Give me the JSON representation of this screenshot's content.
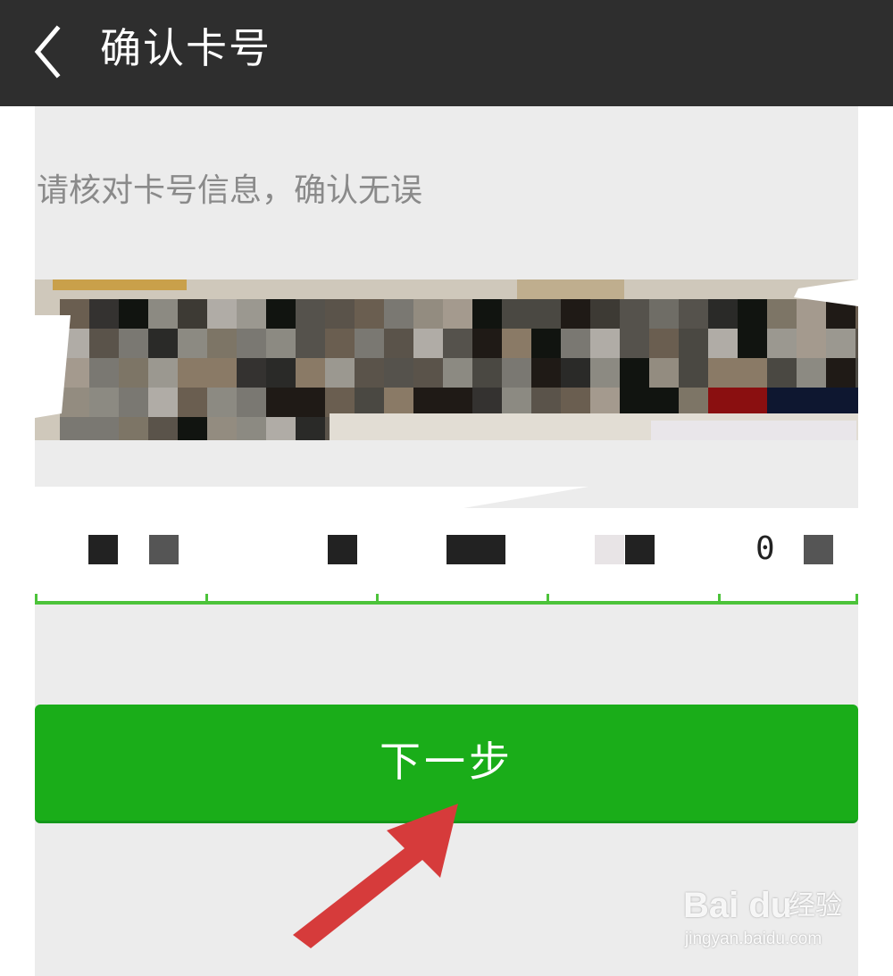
{
  "header": {
    "title": "确认卡号",
    "back_icon": "chevron-left-icon"
  },
  "main": {
    "hint": "请核对卡号信息，确认无误",
    "card_number_visible": [
      "0"
    ],
    "next_button_label": "下一步"
  },
  "watermark": {
    "brand": "Bai du",
    "brand_cn": "经验",
    "url": "jingyan.baidu.com"
  },
  "colors": {
    "titlebar": "#2e2e2e",
    "content_bg": "#ececec",
    "accent_green": "#1aad19",
    "underline_green": "#4cc33a",
    "annotation_arrow": "#d63b3b"
  }
}
